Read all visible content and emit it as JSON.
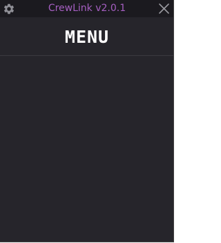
{
  "window": {
    "title": "CrewLink v2.0.1",
    "title_color": "#a65fc2",
    "background": "#26252b",
    "titlebar_background": "#1b1a1f"
  },
  "titlebar": {
    "settings_icon": "gear-icon",
    "close_icon": "close-icon"
  },
  "menu": {
    "heading": "MENU"
  }
}
